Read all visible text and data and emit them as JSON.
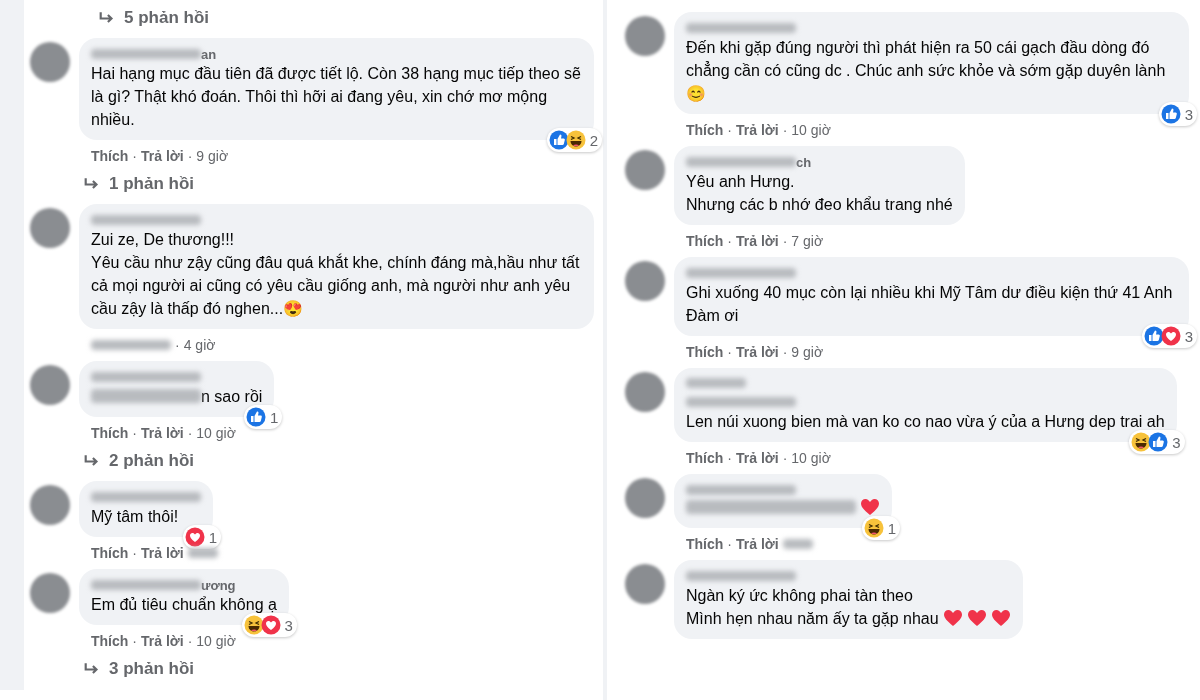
{
  "separator": "·",
  "columns": [
    {
      "top_replies": "5 phản hồi",
      "comments": [
        {
          "name_tail": "an",
          "text": "Hai hạng mục đầu tiên đã được tiết lộ. Còn 38 hạng mục tiếp theo sẽ là gì? Thật khó đoán. Thôi thì hỡi ai đang yêu, xin chớ mơ mộng nhiều.",
          "reactions": {
            "items": [
              {
                "kind": "like"
              },
              {
                "kind": "haha"
              }
            ],
            "count": "2"
          },
          "meta": {
            "like": "Thích",
            "reply": "Trả lời",
            "time": "9 giờ"
          },
          "replies": "1 phản hồi"
        },
        {
          "text": "Zui ze, De thương!!!\nYêu cầu như zậy cũng đâu quá khắt khe, chính đáng mà,hầu như tất cả mọi người ai cũng có yêu cầu giống anh, mà người như anh yêu cầu zậy là thấp đó nghen...😍",
          "meta": {
            "time": "4 giờ"
          }
        },
        {
          "mention_blurred": true,
          "text": "n sao rồi",
          "reactions": {
            "items": [
              {
                "kind": "like"
              }
            ],
            "count": "1"
          },
          "meta": {
            "like": "Thích",
            "reply": "Trả lời",
            "time": "10 giờ"
          },
          "replies": "2 phản hồi"
        },
        {
          "text": "Mỹ tâm thôi!",
          "reactions": {
            "items": [
              {
                "kind": "love"
              }
            ],
            "count": "1"
          },
          "meta": {
            "like": "Thích",
            "reply": "Trả lời"
          }
        },
        {
          "name_tail": "ương",
          "text": "Em đủ tiêu chuẩn không ạ",
          "reactions": {
            "items": [
              {
                "kind": "haha"
              },
              {
                "kind": "love"
              }
            ],
            "count": "3"
          },
          "meta": {
            "like": "Thích",
            "reply": "Trả lời",
            "time": "10 giờ"
          },
          "replies": "3 phản hồi"
        }
      ]
    },
    {
      "comments": [
        {
          "text": "Đến khi gặp đúng người thì phát hiện ra 50 cái gạch đầu dòng đó chẳng cần có cũng dc . Chúc anh sức khỏe và sớm gặp duyên lành 😊",
          "reactions": {
            "items": [
              {
                "kind": "like"
              }
            ],
            "count": "3"
          },
          "meta": {
            "like": "Thích",
            "reply": "Trả lời",
            "time": "10 giờ"
          }
        },
        {
          "name_tail": "ch",
          "text": "Yêu anh Hưng.\nNhưng các b nhớ đeo khẩu trang nhé",
          "meta": {
            "like": "Thích",
            "reply": "Trả lời",
            "time": "7 giờ"
          }
        },
        {
          "text": "Ghi xuống 40 mục còn lại nhiều khi Mỹ Tâm dư điều kiện thứ 41 Anh Đàm ơi",
          "reactions": {
            "items": [
              {
                "kind": "like"
              },
              {
                "kind": "love"
              }
            ],
            "count": "3"
          },
          "meta": {
            "like": "Thích",
            "reply": "Trả lời",
            "time": "9 giờ"
          }
        },
        {
          "fan_badge": true,
          "text": "Len núi xuong bien mà van ko co nao vừa ý của a Hưng dep trai ah",
          "reactions": {
            "items": [
              {
                "kind": "haha"
              },
              {
                "kind": "like"
              }
            ],
            "count": "3"
          },
          "meta": {
            "like": "Thích",
            "reply": "Trả lời",
            "time": "10 giờ"
          }
        },
        {
          "emoji_icons": [
            {
              "kind": "heart"
            }
          ],
          "reactions": {
            "items": [
              {
                "kind": "haha"
              }
            ],
            "count": "1"
          },
          "meta": {
            "like": "Thích",
            "reply": "Trả lời"
          }
        },
        {
          "text": "Ngàn ký ức không phai tàn theo\nMình hẹn nhau năm ấy ta gặp nhau",
          "emoji_icons": [
            {
              "kind": "heart"
            },
            {
              "kind": "heart"
            },
            {
              "kind": "heart"
            }
          ]
        }
      ]
    }
  ]
}
